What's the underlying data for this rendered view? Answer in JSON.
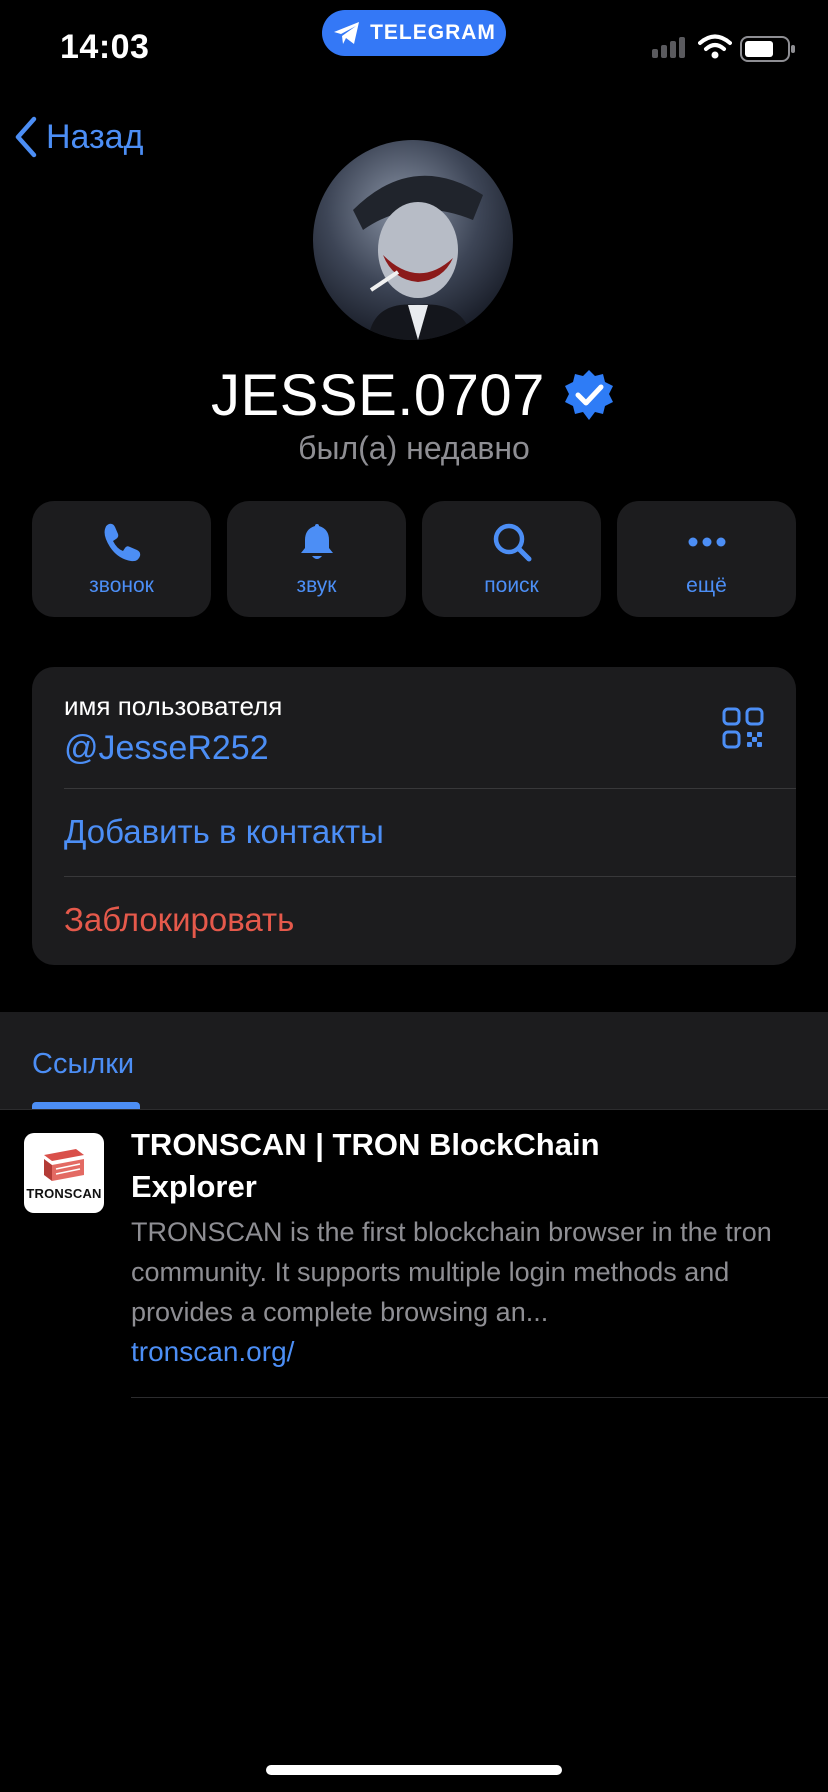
{
  "status_bar": {
    "time": "14:03",
    "app_pill": "TELEGRAM",
    "icons": [
      "signal-icon",
      "wifi-icon",
      "battery-icon"
    ]
  },
  "nav": {
    "back_label": "Назад"
  },
  "profile": {
    "name": "JESSE.0707",
    "verified": true,
    "status": "был(а) недавно"
  },
  "actions": [
    {
      "label": "звонок",
      "icon": "phone-icon"
    },
    {
      "label": "звук",
      "icon": "bell-icon"
    },
    {
      "label": "поиск",
      "icon": "search-icon"
    },
    {
      "label": "ещё",
      "icon": "more-icon"
    }
  ],
  "info": {
    "username_label": "имя пользователя",
    "username": "@JesseR252",
    "add_contact": "Добавить в контакты",
    "block": "Заблокировать"
  },
  "tabs": {
    "active": "Ссылки"
  },
  "links": [
    {
      "favicon_text": "TRONSCAN",
      "title": "TRONSCAN | TRON BlockChain Explorer",
      "description": "TRONSCAN is the first blockchain browser in the tron community. It supports multiple login methods and provides a complete browsing an...",
      "url": "tronscan.org/"
    }
  ],
  "colors": {
    "accent": "#4c8ef5",
    "destructive": "#e5594b",
    "card_bg": "#1c1c1e",
    "background": "#000000"
  }
}
